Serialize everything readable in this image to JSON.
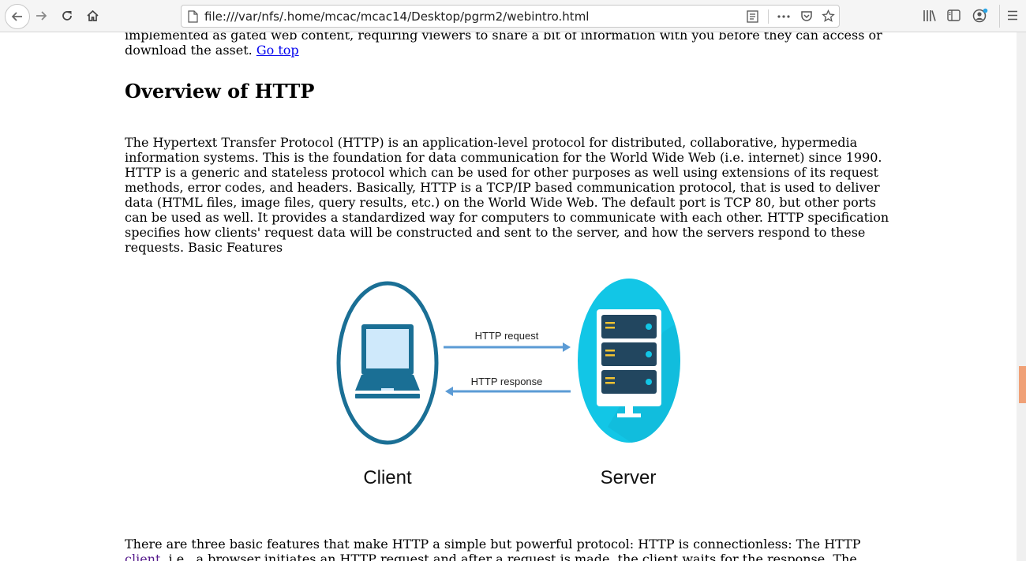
{
  "toolbar": {
    "url": "file:///var/nfs/.home/mcac/mcac14/Desktop/pgrm2/webintro.html",
    "icons": [
      "back-icon",
      "forward-icon",
      "reload-icon",
      "home-icon",
      "page-icon",
      "reader-view-icon",
      "more-icon",
      "pocket-icon",
      "bookmark-star-icon",
      "library-icon",
      "sidebar-icon",
      "account-icon",
      "menu-icon"
    ]
  },
  "content": {
    "top_paragraph": "implemented as gated web content, requiring viewers to share a bit of information with you before they can access or download the asset.",
    "go_top": "Go top",
    "heading": "Overview of HTTP",
    "overview": "The Hypertext Transfer Protocol (HTTP) is an application-level protocol for distributed, collaborative, hypermedia information systems. This is the foundation for data communication for the World Wide Web (i.e. internet) since 1990. HTTP is a generic and stateless protocol which can be used for other purposes as well using extensions of its request methods, error codes, and headers. Basically, HTTP is a TCP/IP based communication protocol, that is used to deliver data (HTML files, image files, query results, etc.) on the World Wide Web. The default port is TCP 80, but other ports can be used as well. It provides a standardized way for computers to communicate with each other. HTTP specification specifies how clients' request data will be constructed and sent to the server, and how the servers respond to these requests. Basic Features",
    "bottom_line1": "There are three basic features that make HTTP a simple but powerful protocol: HTTP is connectionless: The HTTP",
    "bottom_link": "client",
    "bottom_line2": ", i.e., a browser initiates an HTTP request and after a request is made, the client waits for the response. The"
  },
  "diagram": {
    "request_label": "HTTP request",
    "response_label": "HTTP response",
    "client_label": "Client",
    "server_label": "Server",
    "colors": {
      "client_ring": "#1a6f95",
      "server_circle": "#12c6e6",
      "arrow": "#5b9bd5",
      "rack": "#22465f",
      "led": "#f1c232",
      "screen": "#cfe9fb"
    }
  },
  "scrollbar": {
    "thumb_color": "#f0a177"
  }
}
